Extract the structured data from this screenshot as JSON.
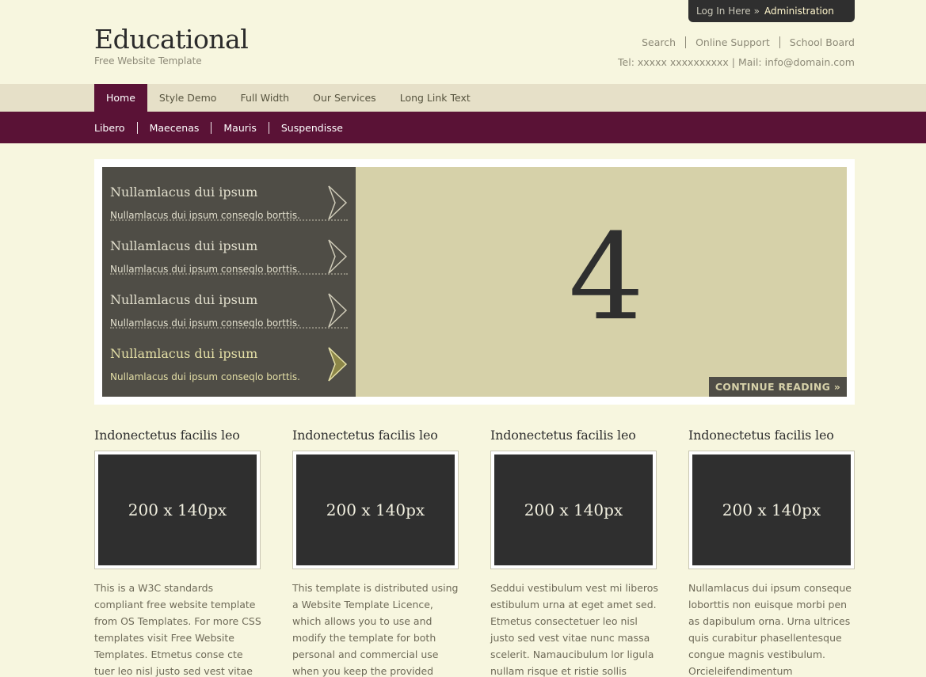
{
  "login": {
    "login_label": "Log In Here",
    "sep": "»",
    "admin_label": "Administration"
  },
  "site": {
    "title": "Educational",
    "tagline": "Free Website Template"
  },
  "toplinks": [
    "Search",
    "Online Support",
    "School Board"
  ],
  "contact": "Tel: xxxxx xxxxxxxxxx | Mail: info@domain.com",
  "main_nav": [
    {
      "label": "Home",
      "active": true
    },
    {
      "label": "Style Demo",
      "active": false
    },
    {
      "label": "Full Width",
      "active": false
    },
    {
      "label": "Our Services",
      "active": false
    },
    {
      "label": "Long Link Text",
      "active": false
    }
  ],
  "sub_nav": [
    "Libero",
    "Maecenas",
    "Mauris",
    "Suspendisse"
  ],
  "slider": {
    "items": [
      {
        "title": "Nullamlacus dui ipsum",
        "desc": "Nullamlacus dui ipsum conseqlo borttis."
      },
      {
        "title": "Nullamlacus dui ipsum",
        "desc": "Nullamlacus dui ipsum conseqlo borttis."
      },
      {
        "title": "Nullamlacus dui ipsum",
        "desc": "Nullamlacus dui ipsum conseqlo borttis."
      },
      {
        "title": "Nullamlacus dui ipsum",
        "desc": "Nullamlacus dui ipsum conseqlo borttis."
      }
    ],
    "active_index": 3,
    "current_slide": "4",
    "continue_label": "CONTINUE READING »"
  },
  "columns": [
    {
      "title": "Indonectetus facilis leo",
      "image_text": "200 x 140px",
      "text": "This is a W3C standards compliant free website template from OS Templates. For more CSS templates visit Free Website Templates. Etmetus conse cte tuer leo nisl justo sed vest vitae"
    },
    {
      "title": "Indonectetus facilis leo",
      "image_text": "200 x 140px",
      "text": "This template is distributed using a Website Template Licence, which allows you to use and modify the template for both personal and commercial use when you keep the provided credit"
    },
    {
      "title": "Indonectetus facilis leo",
      "image_text": "200 x 140px",
      "text": "Seddui vestibulum vest mi liberos estibulum urna at eget amet sed. Etmetus consectetuer leo nisl justo sed vest vitae nunc massa scelerit. Namaucibulum lor ligula nullam risque et ristie sollis sapien"
    },
    {
      "title": "Indonectetus facilis leo",
      "image_text": "200 x 140px",
      "text": "Nullamlacus dui ipsum conseque loborttis non euisque morbi pen as dapibulum orna. Urna ultrices quis curabitur phasellentesque congue magnis vestibulum. Orcieleifendimentum"
    }
  ],
  "colors": {
    "brand": "#5a1236",
    "bg": "#f7f6df",
    "slider_panel": "#d6d1a9",
    "dark": "#4f4d46"
  }
}
